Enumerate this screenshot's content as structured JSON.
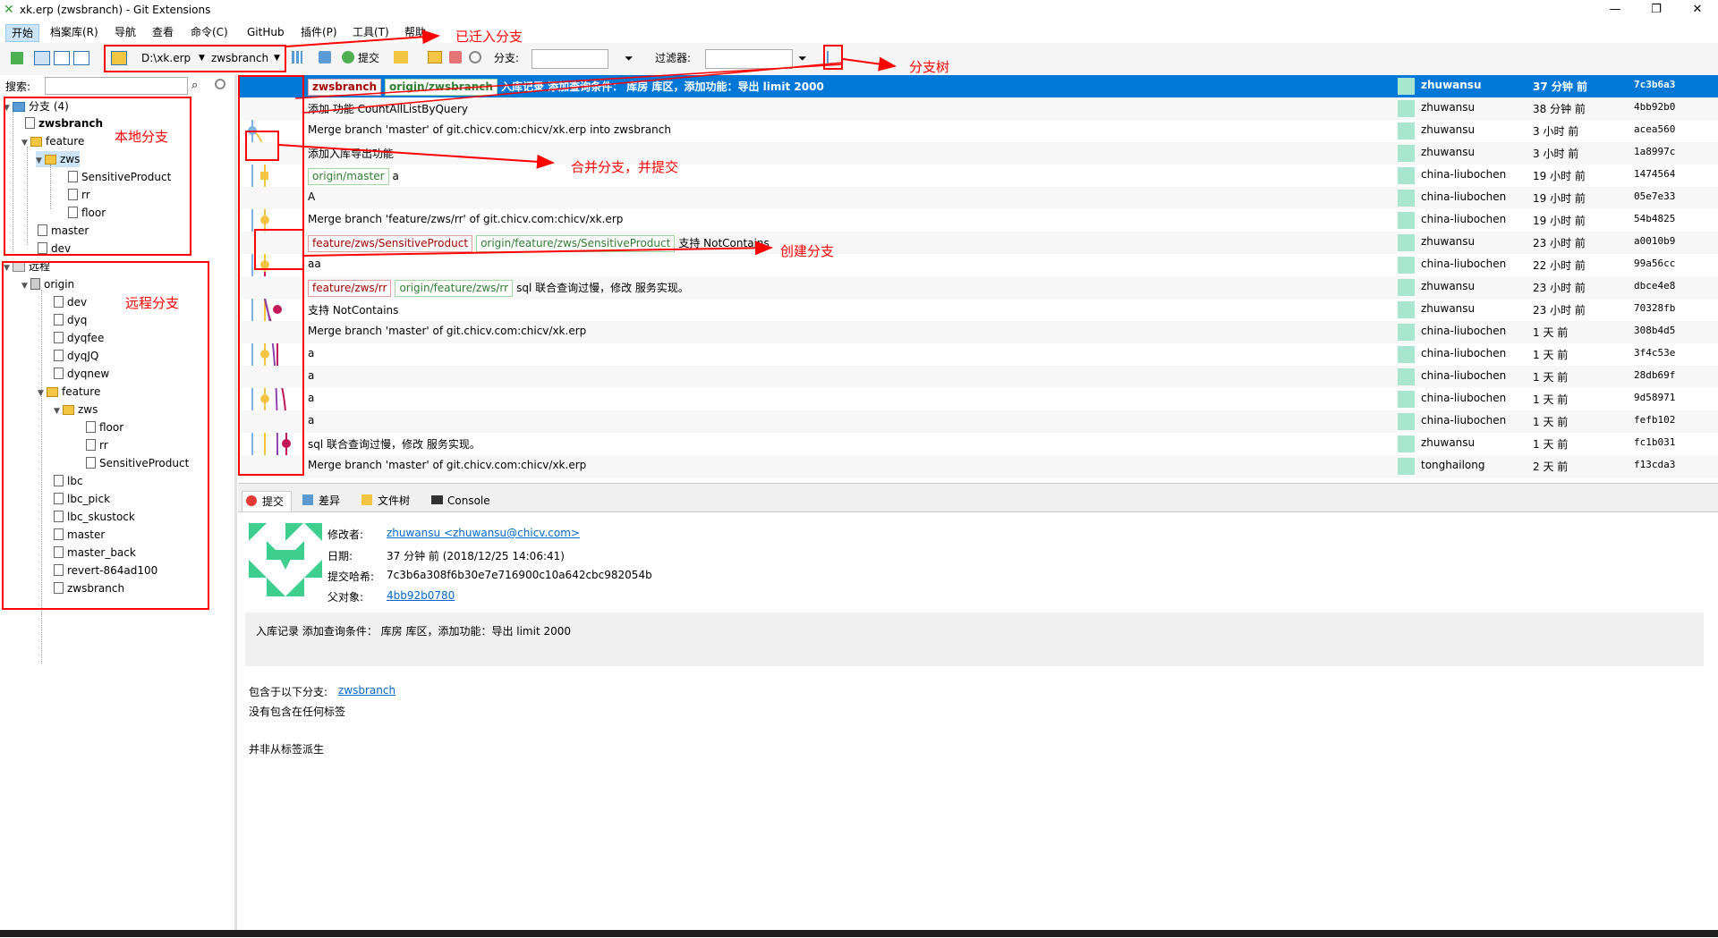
{
  "window": {
    "title": "xk.erp (zwsbranch) - Git Extensions",
    "minimize": "—",
    "maximize": "❐",
    "close": "✕"
  },
  "menu": [
    "开始",
    "档案库(R)",
    "导航",
    "查看",
    "命令(C)",
    "GitHub",
    "插件(P)",
    "工具(T)",
    "帮助"
  ],
  "toolbar": {
    "repo": "D:\\xk.erp",
    "branch": "zwsbranch",
    "commit_label": "提交",
    "branch_filter_label": "分支:",
    "filter_label": "过滤器:"
  },
  "search": {
    "label": "搜索:"
  },
  "tree": {
    "branches_root": "分支 (4)",
    "local": [
      "zwsbranch",
      "feature",
      "zws",
      "SensitiveProduct",
      "rr",
      "floor",
      "master",
      "dev"
    ],
    "remote_root": "远程",
    "origin": "origin",
    "remote": [
      "dev",
      "dyq",
      "dyqfee",
      "dyqJQ",
      "dyqnew",
      "feature",
      "zws",
      "floor",
      "rr",
      "SensitiveProduct",
      "lbc",
      "lbc_pick",
      "lbc_skustock",
      "master",
      "master_back",
      "revert-864ad100",
      "zwsbranch"
    ]
  },
  "commits": [
    {
      "labels_local": [
        "zwsbranch"
      ],
      "labels_remote": [
        "origin/zwsbranch"
      ],
      "message": "入库记录 添加查询条件： 库房 库区，添加功能：导出 limit 2000",
      "author": "zhuwansu",
      "date": "37 分钟 前",
      "hash": "7c3b6a3"
    },
    {
      "labels_local": [],
      "labels_remote": [],
      "message": "添加 功能 CountAllListByQuery",
      "author": "zhuwansu",
      "date": "38 分钟 前",
      "hash": "4bb92b0"
    },
    {
      "labels_local": [],
      "labels_remote": [],
      "message": "Merge branch 'master' of git.chicv.com:chicv/xk.erp into zwsbranch",
      "author": "zhuwansu",
      "date": "3 小时 前",
      "hash": "acea560"
    },
    {
      "labels_local": [],
      "labels_remote": [],
      "message": "添加入库导出功能",
      "author": "zhuwansu",
      "date": "3 小时 前",
      "hash": "1a8997c"
    },
    {
      "labels_local": [],
      "labels_remote": [
        "origin/master"
      ],
      "message": "a",
      "author": "china-liubochen",
      "date": "19 小时 前",
      "hash": "1474564"
    },
    {
      "labels_local": [],
      "labels_remote": [],
      "message": "A",
      "author": "china-liubochen",
      "date": "19 小时 前",
      "hash": "05e7e33"
    },
    {
      "labels_local": [],
      "labels_remote": [],
      "message": "Merge branch 'feature/zws/rr' of git.chicv.com:chicv/xk.erp",
      "author": "china-liubochen",
      "date": "19 小时 前",
      "hash": "54b4825"
    },
    {
      "labels_local": [
        "feature/zws/SensitiveProduct"
      ],
      "labels_remote": [
        "origin/feature/zws/SensitiveProduct"
      ],
      "message": "支持 NotContains",
      "author": "zhuwansu",
      "date": "23 小时 前",
      "hash": "a0010b9"
    },
    {
      "labels_local": [],
      "labels_remote": [],
      "message": "aa",
      "author": "china-liubochen",
      "date": "22 小时 前",
      "hash": "99a56cc"
    },
    {
      "labels_local": [
        "feature/zws/rr"
      ],
      "labels_remote": [
        "origin/feature/zws/rr"
      ],
      "message": "sql 联合查询过慢，修改 服务实现。",
      "author": "zhuwansu",
      "date": "23 小时 前",
      "hash": "dbce4e8"
    },
    {
      "labels_local": [],
      "labels_remote": [],
      "message": "支持 NotContains",
      "author": "zhuwansu",
      "date": "23 小时 前",
      "hash": "70328fb"
    },
    {
      "labels_local": [],
      "labels_remote": [],
      "message": "Merge branch 'master' of git.chicv.com:chicv/xk.erp",
      "author": "china-liubochen",
      "date": "1 天 前",
      "hash": "308b4d5"
    },
    {
      "labels_local": [],
      "labels_remote": [],
      "message": "a",
      "author": "china-liubochen",
      "date": "1 天 前",
      "hash": "3f4c53e"
    },
    {
      "labels_local": [],
      "labels_remote": [],
      "message": "a",
      "author": "china-liubochen",
      "date": "1 天 前",
      "hash": "28db69f"
    },
    {
      "labels_local": [],
      "labels_remote": [],
      "message": "a",
      "author": "china-liubochen",
      "date": "1 天 前",
      "hash": "9d58971"
    },
    {
      "labels_local": [],
      "labels_remote": [],
      "message": "a",
      "author": "china-liubochen",
      "date": "1 天 前",
      "hash": "fefb102"
    },
    {
      "labels_local": [],
      "labels_remote": [],
      "message": "sql 联合查询过慢，修改 服务实现。",
      "author": "zhuwansu",
      "date": "1 天 前",
      "hash": "fc1b031"
    },
    {
      "labels_local": [],
      "labels_remote": [],
      "message": "Merge branch 'master' of git.chicv.com:chicv/xk.erp",
      "author": "tonghailong",
      "date": "2 天 前",
      "hash": "f13cda3"
    }
  ],
  "tabs": [
    "提交",
    "差异",
    "文件树",
    "Console"
  ],
  "detail": {
    "author_label": "修改者:",
    "author": "zhuwansu <zhuwansu@chicv.com>",
    "date_label": "日期:",
    "date": "37 分钟 前 (2018/12/25 14:06:41)",
    "hash_label": "提交哈希:",
    "hash": "7c3b6a308f6b30e7e716900c10a642cbc982054b",
    "parent_label": "父对象:",
    "parent": "4bb92b0780",
    "message": "入库记录 添加查询条件： 库房 库区，添加功能：导出 limit 2000",
    "contained_label": "包含于以下分支:",
    "contained_branch": "zwsbranch",
    "no_tags": "没有包含在任何标签",
    "not_derived": "并非从标签派生"
  },
  "annotations": {
    "checked_out": "已迁入分支",
    "branch_tree": "分支树",
    "local_branches": "本地分支",
    "remote_branches": "远程分支",
    "merge": "合并分支，并提交",
    "create": "创建分支"
  },
  "colors": {
    "accent": "#0078d7",
    "annotation": "#ff0000"
  }
}
